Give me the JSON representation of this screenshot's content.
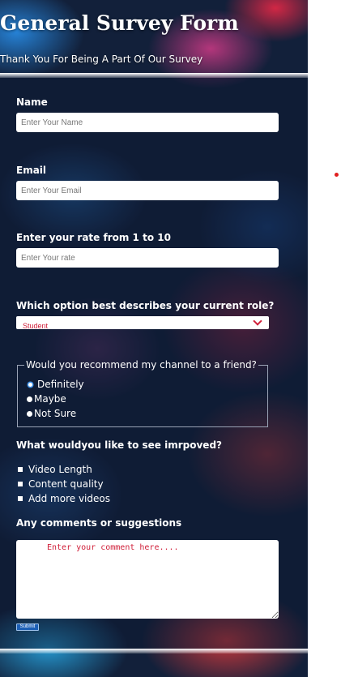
{
  "header": {
    "title": "General Survey Form",
    "subtitle": "Thank You For Being A Part Of Our Survey"
  },
  "form": {
    "name": {
      "label": "Name",
      "placeholder": "Enter Your Name"
    },
    "email": {
      "label": "Email",
      "placeholder": "Enter Your Email"
    },
    "rate": {
      "label": "Enter your rate from 1 to 10",
      "placeholder": "Enter Your rate"
    },
    "role": {
      "label": "Which option best describes your current role?",
      "selected": "Student"
    },
    "recommend": {
      "legend": "Would you recommend my channel to a friend?",
      "options": [
        "Definitely",
        "Maybe",
        "Not Sure"
      ],
      "selected_index": 0
    },
    "improve": {
      "label": "What wouldyou like to see imrpoved?",
      "options": [
        "Video Length",
        "Content quality",
        "Add more videos"
      ]
    },
    "comments": {
      "label": "Any comments or suggestions",
      "placeholder": "Enter your comment here...."
    },
    "submit_label": "Submit"
  },
  "colors": {
    "accent_red": "#d0203a",
    "page_dark": "#12203a",
    "radio_selected": "#3a8ee6",
    "submit_bg": "#1c5fb5"
  }
}
